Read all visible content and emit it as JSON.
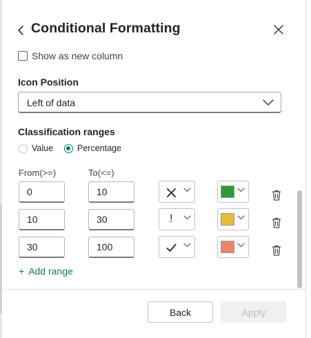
{
  "header": {
    "title": "Conditional Formatting",
    "back_icon": "chevron-left-icon",
    "close_icon": "close-icon"
  },
  "options": {
    "show_new_column_label": "Show as new column",
    "show_new_column_checked": false
  },
  "icon_position": {
    "label": "Icon Position",
    "selected": "Left of data"
  },
  "classification": {
    "label": "Classification ranges",
    "radio_value_label": "Value",
    "radio_percentage_label": "Percentage",
    "selected": "Percentage",
    "from_header": "From(>=)",
    "to_header": "To(<=)",
    "ranges": [
      {
        "from": "0",
        "to": "10",
        "icon": "cross-icon",
        "color": "#2e9a3c"
      },
      {
        "from": "10",
        "to": "30",
        "icon": "exclamation-icon",
        "color": "#e3bd36"
      },
      {
        "from": "30",
        "to": "100",
        "icon": "checkmark-icon",
        "color": "#e8866a"
      }
    ],
    "exclamation_glyph": "!",
    "add_range_plus": "+",
    "add_range_label": "Add range"
  },
  "footer": {
    "back_label": "Back",
    "apply_label": "Apply",
    "apply_enabled": false
  },
  "colors": {
    "accent": "#107c6c",
    "link": "#0f7b6c"
  }
}
